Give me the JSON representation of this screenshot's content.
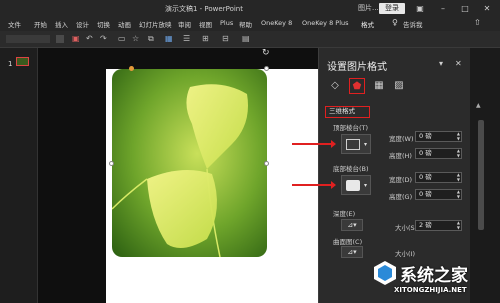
{
  "titlebar": {
    "title": "演示文稿1  -  PowerPoint",
    "picture_tools": "图片...",
    "login": "登录"
  },
  "menu": {
    "items": [
      "文件",
      "开始",
      "插入",
      "设计",
      "切换",
      "动画",
      "幻灯片放映",
      "审阅",
      "视图",
      "Plus",
      "帮助",
      "OneKey 8",
      "OneKey 8 Plus",
      "格式"
    ],
    "search": "告诉我"
  },
  "thumbnails": {
    "slide_number": "1"
  },
  "panel": {
    "title": "设置图片格式",
    "section": "三维格式",
    "top_bevel_label": "顶部棱台(T)",
    "bottom_bevel_label": "底部棱台(B)",
    "width_label": "宽度(W)",
    "height_label": "高度(H)",
    "width_label_bottom": "宽度(D)",
    "height_label_bottom": "高度(G)",
    "top_width_value": "0 磅",
    "top_height_value": "0 磅",
    "bottom_width_value": "0 磅",
    "bottom_height_value": "0 磅",
    "depth_label": "深度(E)",
    "size_label": "大小(S)",
    "size_value": "2 磅",
    "contour_label": "曲面图(C)",
    "size_label_2": "大小(I)"
  },
  "watermark": {
    "main": "系统之家",
    "sub": "XITONGZHIJIA.NET"
  },
  "colors": {
    "accent_red": "#e02020",
    "dark_bg": "#1f1f1f",
    "panel_bg": "#2b2b2b"
  }
}
